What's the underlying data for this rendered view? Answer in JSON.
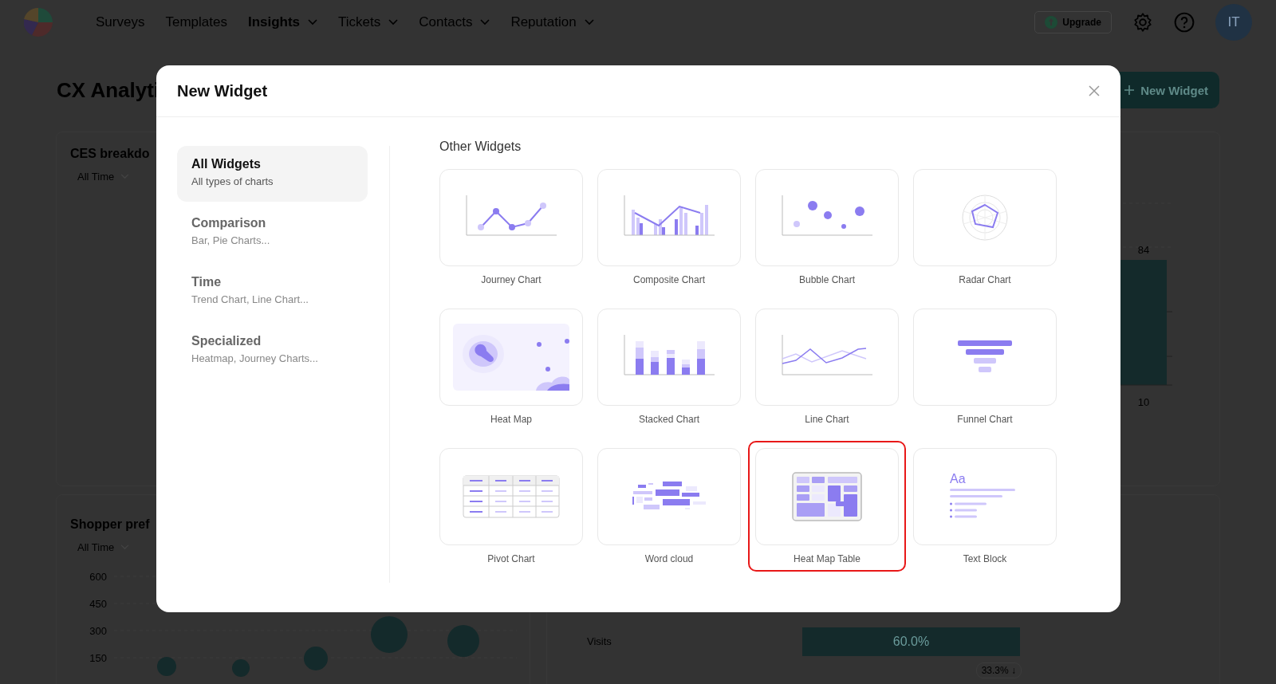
{
  "nav": {
    "items": [
      {
        "label": "Surveys",
        "selected": false,
        "dropdown": false
      },
      {
        "label": "Templates",
        "selected": false,
        "dropdown": false
      },
      {
        "label": "Insights",
        "selected": true,
        "dropdown": true
      },
      {
        "label": "Tickets",
        "selected": false,
        "dropdown": true
      },
      {
        "label": "Contacts",
        "selected": false,
        "dropdown": true
      },
      {
        "label": "Reputation",
        "selected": false,
        "dropdown": true
      }
    ],
    "upgrade": "Upgrade",
    "avatar": "IT"
  },
  "page": {
    "title": "CX Analyti",
    "new_widget": "New Widget"
  },
  "cards": [
    {
      "title": "CES breakdo",
      "filter": "All Time"
    },
    {
      "title": "Shopper pref",
      "filter": "All Time",
      "yticks": [
        "600",
        "450",
        "300",
        "150"
      ]
    }
  ],
  "bar_card": {
    "value_label": "84",
    "axis_label": "10"
  },
  "funnel": {
    "stage": "Visits",
    "share": "60.0%",
    "drop": "33.3% ↓"
  },
  "modal": {
    "title": "New Widget",
    "categories": [
      {
        "title": "All Widgets",
        "subtitle": "All types of charts",
        "selected": true
      },
      {
        "title": "Comparison",
        "subtitle": "Bar, Pie Charts...",
        "selected": false
      },
      {
        "title": "Time",
        "subtitle": "Trend Chart, Line Chart...",
        "selected": false
      },
      {
        "title": "Specialized",
        "subtitle": "Heatmap, Journey Charts...",
        "selected": false
      }
    ],
    "section": "Other Widgets",
    "widgets": [
      {
        "label": "Journey Chart",
        "kind": "journey",
        "selected": false
      },
      {
        "label": "Composite Chart",
        "kind": "composite",
        "selected": false
      },
      {
        "label": "Bubble Chart",
        "kind": "bubble",
        "selected": false
      },
      {
        "label": "Radar Chart",
        "kind": "radar",
        "selected": false
      },
      {
        "label": "Heat Map",
        "kind": "heatmap",
        "selected": false
      },
      {
        "label": "Stacked Chart",
        "kind": "stacked",
        "selected": false
      },
      {
        "label": "Line Chart",
        "kind": "line",
        "selected": false
      },
      {
        "label": "Funnel Chart",
        "kind": "funnel",
        "selected": false
      },
      {
        "label": "Pivot Chart",
        "kind": "pivot",
        "selected": false
      },
      {
        "label": "Word cloud",
        "kind": "wordcloud",
        "selected": false
      },
      {
        "label": "Heat Map Table",
        "kind": "heattable",
        "selected": true
      },
      {
        "label": "Text Block",
        "kind": "text",
        "selected": false,
        "icon_text": "Aa"
      }
    ]
  }
}
